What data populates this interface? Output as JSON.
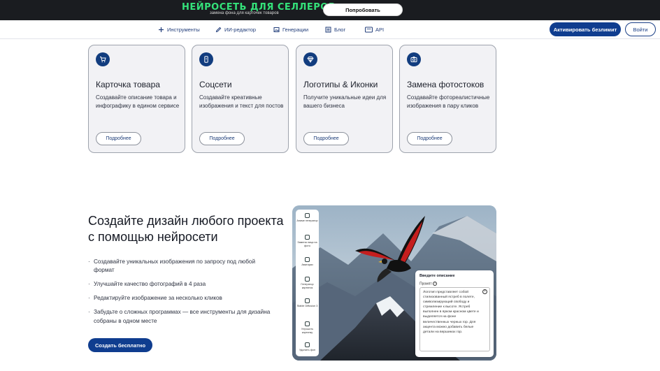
{
  "banner": {
    "title": "НЕЙРОСЕТЬ ДЛЯ СЕЛЛЕРОВ",
    "subtitle": "замена фона для карточек товаров",
    "button": "Попробовать"
  },
  "nav": {
    "items": [
      {
        "label": "Инструменты",
        "icon": "plus-icon"
      },
      {
        "label": "ИИ-редактор",
        "icon": "pencil-icon"
      },
      {
        "label": "Генерации",
        "icon": "image-icon"
      },
      {
        "label": "Блог",
        "icon": "document-icon"
      },
      {
        "label": "API",
        "icon": "terminal-icon"
      }
    ],
    "activate_label": "Активировать безлимит",
    "login_label": "Войти"
  },
  "cards": [
    {
      "title": "Карточка товара",
      "desc": "Создавайте описание товара и инфографику в едином сервисе",
      "button": "Подробнее",
      "icon": "cart-icon"
    },
    {
      "title": "Соцсети",
      "desc": "Создавайте креативные изображения и текст для постов",
      "button": "Подробнее",
      "icon": "phone-icon"
    },
    {
      "title": "Логотипы & Иконки",
      "desc": "Получите уникальные идеи для вашего бизнеса",
      "button": "Подробнее",
      "icon": "diamond-icon"
    },
    {
      "title": "Замена фотостоков",
      "desc": "Создавайте фотореалистичные изображения в пару кликов",
      "button": "Подробнее",
      "icon": "camera-icon"
    }
  ],
  "hero": {
    "title": "Создайте дизайн любого проекта с помощью нейросети",
    "features": [
      "Создавайте уникальных изображения по запросу под любой формат",
      "Улучшайте качество фотографий в 4 раза",
      "Редактируйте изображение за несколько кликов",
      "Забудьте о сложных программах — все инструменты для дизайна собраны в одном месте"
    ],
    "cta": "Создать бесплатно"
  },
  "preview": {
    "tools": [
      "Аниме генератор",
      "Замена лица на фото",
      "Аватарки",
      "Генератор картинок",
      "Stable Diffusion 3",
      "Улучшить картинку",
      "Удалить фон"
    ],
    "prompt_title": "Введите описание",
    "prompt_label": "Промпт",
    "prompt_text": "Логотип представляет собой стилизованный ястреб в полете, символизирующий свободу и стремление к высоте. Ястреб выполнен в ярком красном цвете и выделяется на фоне величественных черных гор. Для акцента можно добавить белые детали на вершинах гор."
  },
  "colors": {
    "brand": "#0f3d8f",
    "banner_bg": "#1a1c20",
    "banner_accent": "#34e27a",
    "card_bg": "#f2f2f5"
  }
}
